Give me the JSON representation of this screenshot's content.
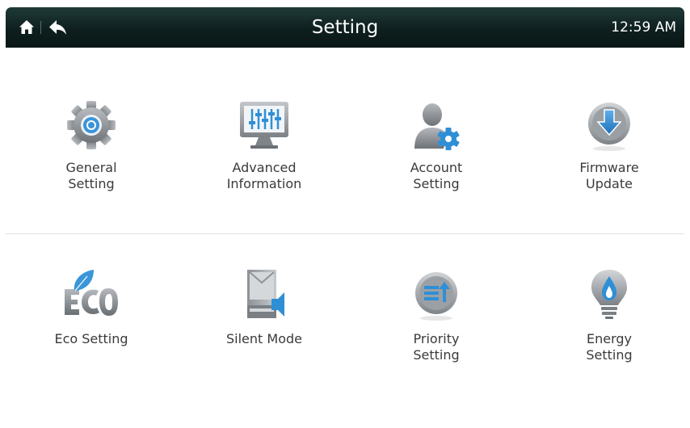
{
  "header": {
    "title": "Setting",
    "time": "12:59 AM",
    "home_icon": "home-icon",
    "back_icon": "back-icon"
  },
  "colors": {
    "header_bg": "#0e1f1e",
    "accent_blue": "#2f8fd6",
    "icon_gray": "#8a8e93",
    "label_text": "#3a3a3a"
  },
  "tiles": [
    {
      "label_line1": "General",
      "label_line2": "Setting",
      "icon": "gear-icon"
    },
    {
      "label_line1": "Advanced",
      "label_line2": "Information",
      "icon": "monitor-equalizer-icon"
    },
    {
      "label_line1": "Account",
      "label_line2": "Setting",
      "icon": "user-gear-icon"
    },
    {
      "label_line1": "Firmware",
      "label_line2": "Update",
      "icon": "download-arrow-icon"
    },
    {
      "label_line1": "Eco Setting",
      "label_line2": "",
      "icon": "eco-leaf-icon"
    },
    {
      "label_line1": "Silent Mode",
      "label_line2": "",
      "icon": "silent-unit-icon"
    },
    {
      "label_line1": "Priority",
      "label_line2": "Setting",
      "icon": "priority-icon"
    },
    {
      "label_line1": "Energy",
      "label_line2": "Setting",
      "icon": "energy-bulb-icon"
    }
  ]
}
